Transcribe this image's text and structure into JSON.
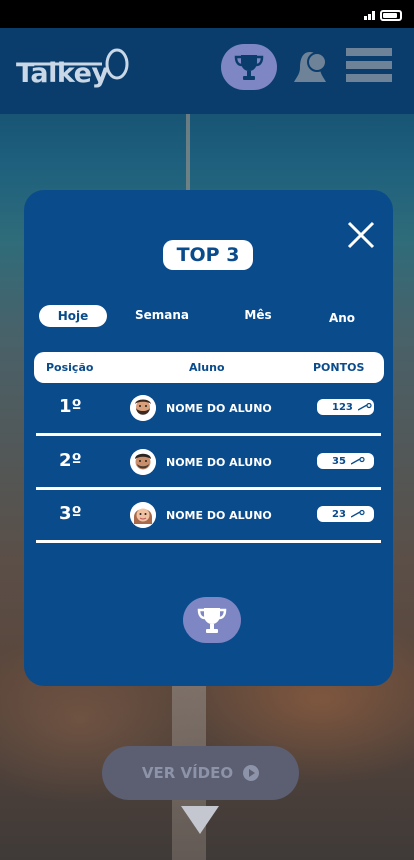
{
  "header": {
    "logo_text": "Talkey",
    "icons": [
      "trophy-icon",
      "bell-icon",
      "hamburger-menu-icon"
    ]
  },
  "modal": {
    "title": "TOP 3",
    "close_icon": "close-icon",
    "tabs": [
      {
        "label": "Hoje",
        "active": true
      },
      {
        "label": "Semana",
        "active": false
      },
      {
        "label": "Mês",
        "active": false
      },
      {
        "label": "Ano",
        "active": false
      }
    ],
    "columns": [
      "Posição",
      "Aluno",
      "PONTOS"
    ],
    "rows": [
      {
        "position": "1º",
        "student": "NOME DO ALUNO",
        "points": "123",
        "avatar": "avatar-man-bearded-icon"
      },
      {
        "position": "2º",
        "student": "NOME DO ALUNO",
        "points": "35",
        "avatar": "avatar-man-icon"
      },
      {
        "position": "3º",
        "student": "NOME DO ALUNO",
        "points": "23",
        "avatar": "avatar-woman-icon"
      }
    ],
    "footer_icon": "trophy-icon"
  },
  "video_button": {
    "label": "VER VÍDEO",
    "icon": "play-icon"
  },
  "colors": {
    "header_bg": "#0a3d6b",
    "modal_bg": "#0a4b8c",
    "accent_purple": "#7e86c4",
    "text_white": "#ffffff"
  }
}
